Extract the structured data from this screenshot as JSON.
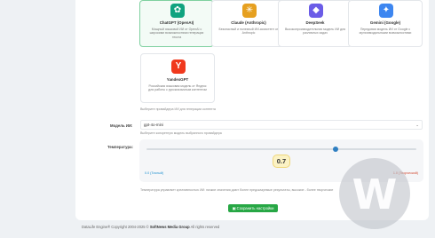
{
  "providers": [
    {
      "name": "ChatGPT (OpenAI)",
      "desc": "Мощный языковой ИИ от OpenAI с широкими возможностями генерации текста",
      "icon": "openai-icon",
      "glyph": "✿",
      "color": "#10a37f",
      "selected": true
    },
    {
      "name": "Claude (Anthropic)",
      "desc": "Безопасный и полезный ИИ-ассистент от Anthropic",
      "icon": "claude-icon",
      "glyph": "✳",
      "color": "#e6a020",
      "selected": false
    },
    {
      "name": "DeepSeek",
      "desc": "Высокопроизводительная модель ИИ для различных задач",
      "icon": "deepseek-icon",
      "glyph": "◆",
      "color": "#6b5ce7",
      "selected": false
    },
    {
      "name": "Gemini (Google)",
      "desc": "Передовая модель ИИ от Google с мультимодальными возможностями",
      "icon": "gemini-icon",
      "glyph": "✦",
      "color": "#3d86f0",
      "selected": false
    },
    {
      "name": "YandexGPT",
      "desc": "Российская языковая модель от Яндекс для работы с русскоязычным контентом",
      "icon": "yandex-icon",
      "glyph": "Y",
      "color": "#f0391d",
      "selected": false
    }
  ],
  "provider_hint": "Выберите провайдера ИИ для генерации контента",
  "model": {
    "label": "Модель ИИ:",
    "value": "gpt-4o-mini",
    "hint": "Выберите конкретную модель выбранного провайдера"
  },
  "temperature": {
    "label": "Температура:",
    "value": 0.7,
    "display": "0.7",
    "min": 0,
    "max": 1,
    "min_label": "0.0 (Точный)",
    "max_label": "1.0 (Творческий)",
    "hint": "Температура управляет креативностью ИИ: низкие значения дают более предсказуемые результаты, высокие - более творческие"
  },
  "save_label": "Сохранить настройки",
  "save_icon": "floppy-icon",
  "footer": {
    "pre": "DataLife Engine® Copyright 2004-2025 ©",
    "company": "SoftNews Media Group",
    "post": "All rights reserved"
  },
  "watermark": "W"
}
